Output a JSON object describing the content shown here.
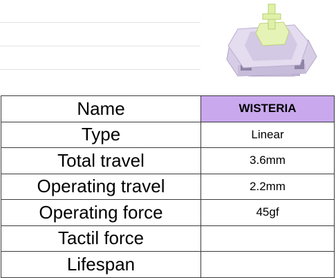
{
  "specs": {
    "rows": [
      {
        "label": "Name",
        "value": "WISTERIA",
        "highlight": true
      },
      {
        "label": "Type",
        "value": "Linear"
      },
      {
        "label": "Total travel",
        "value": "3.6mm"
      },
      {
        "label": "Operating travel",
        "value": "2.2mm"
      },
      {
        "label": "Operating force",
        "value": "45gf"
      },
      {
        "label": "Tactil force",
        "value": ""
      },
      {
        "label": "Lifespan",
        "value": ""
      }
    ]
  },
  "colors": {
    "name_highlight": "#c9a8ee",
    "switch_housing": "#d9cfe6",
    "switch_stem": "#dff1a8"
  },
  "image": {
    "icon": "keyboard-switch-icon"
  }
}
